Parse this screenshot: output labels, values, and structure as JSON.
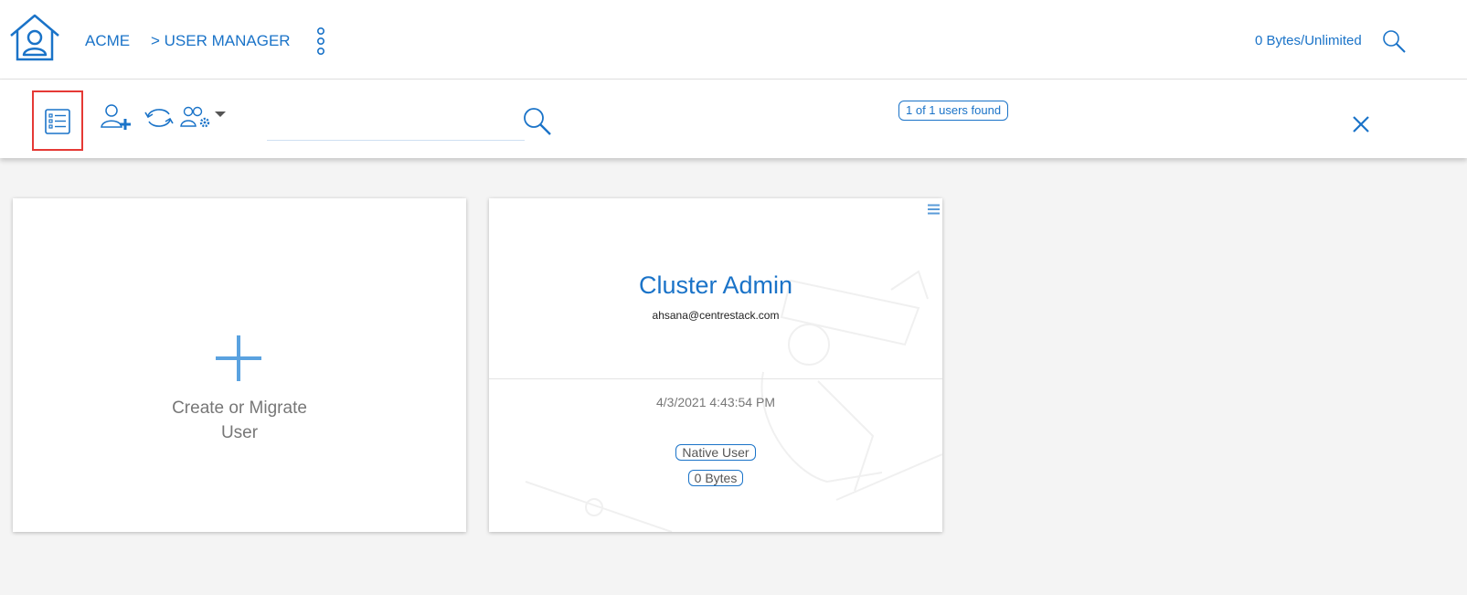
{
  "header": {
    "home_icon": "home-user-icon",
    "breadcrumb_root": "ACME",
    "breadcrumb_current": "> USER MANAGER",
    "more_icon": "vertical-ellipsis-icon",
    "quota": "0 Bytes/Unlimited",
    "search_icon": "search-icon"
  },
  "toolbar": {
    "list_view_icon": "list-view-icon",
    "add_user_icon": "add-user-icon",
    "sync_icon": "sync-icon",
    "user_settings_icon": "user-group-settings-icon",
    "search_placeholder": "",
    "search_value": "",
    "found_text": "1 of 1 users found",
    "close_icon": "close-icon"
  },
  "create_card": {
    "label": "Create or Migrate\nUser",
    "icon": "plus-icon"
  },
  "user_card": {
    "name": "Cluster Admin",
    "email": "ahsana@centrestack.com",
    "date": "4/3/2021 4:43:54 PM",
    "type_badge": "Native User",
    "size_badge": "0 Bytes",
    "menu_icon": "hamburger-menu-icon"
  },
  "colors": {
    "accent": "#1a73c8",
    "highlight": "#e53935",
    "background": "#f4f4f4"
  }
}
